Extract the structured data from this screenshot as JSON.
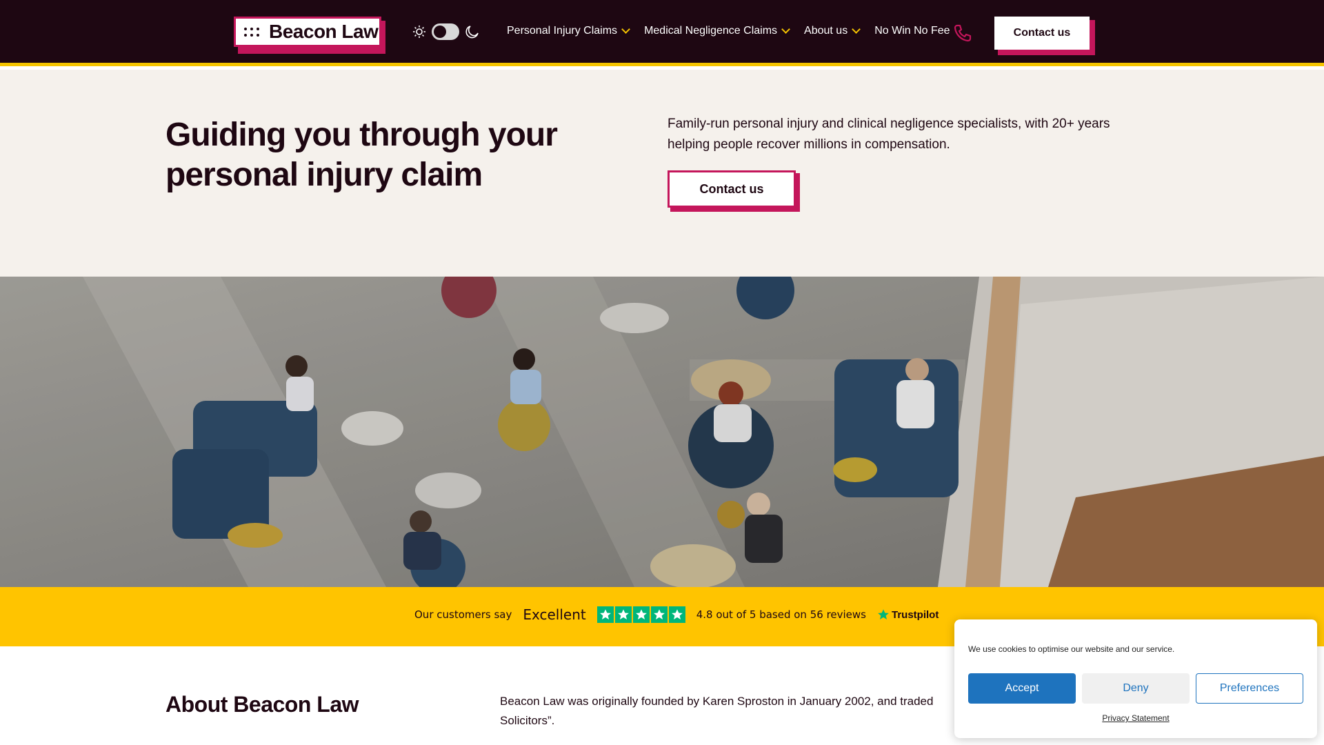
{
  "brand": {
    "name": "Beacon Law",
    "accent": "#c4165b",
    "dark": "#1e0712",
    "yellow": "#ffc400"
  },
  "nav": {
    "items": [
      {
        "label": "Personal Injury Claims",
        "has_dropdown": true
      },
      {
        "label": "Medical Negligence Claims",
        "has_dropdown": true
      },
      {
        "label": "About us",
        "has_dropdown": true
      },
      {
        "label": "No Win No Fee",
        "has_dropdown": false
      }
    ],
    "cta": "Contact us",
    "theme_toggle": {
      "sun_icon": "sun-icon",
      "moon_icon": "moon-icon",
      "state": "light"
    },
    "phone_icon": "phone-icon"
  },
  "hero": {
    "title": "Guiding you through your personal injury claim",
    "text": "Family-run personal injury and clinical negligence specialists, with 20+ years helping people recover millions in compensation.",
    "cta": "Contact us"
  },
  "trustpilot": {
    "intro": "Our customers say",
    "rating_word": "Excellent",
    "stars": 5,
    "score_text": "4.8 out of 5 based on 56 reviews",
    "brand": "Trustpilot",
    "star_color": "#00b67a"
  },
  "about": {
    "title": "About Beacon Law",
    "text_line1": "Beacon Law was originally founded by Karen Sproston in January 2002, and traded",
    "text_line2": "Solicitors”."
  },
  "cookie": {
    "message": "We use cookies to optimise our website and our service.",
    "accept": "Accept",
    "deny": "Deny",
    "preferences": "Preferences",
    "privacy_link": "Privacy Statement",
    "button_color": "#1e73be"
  }
}
